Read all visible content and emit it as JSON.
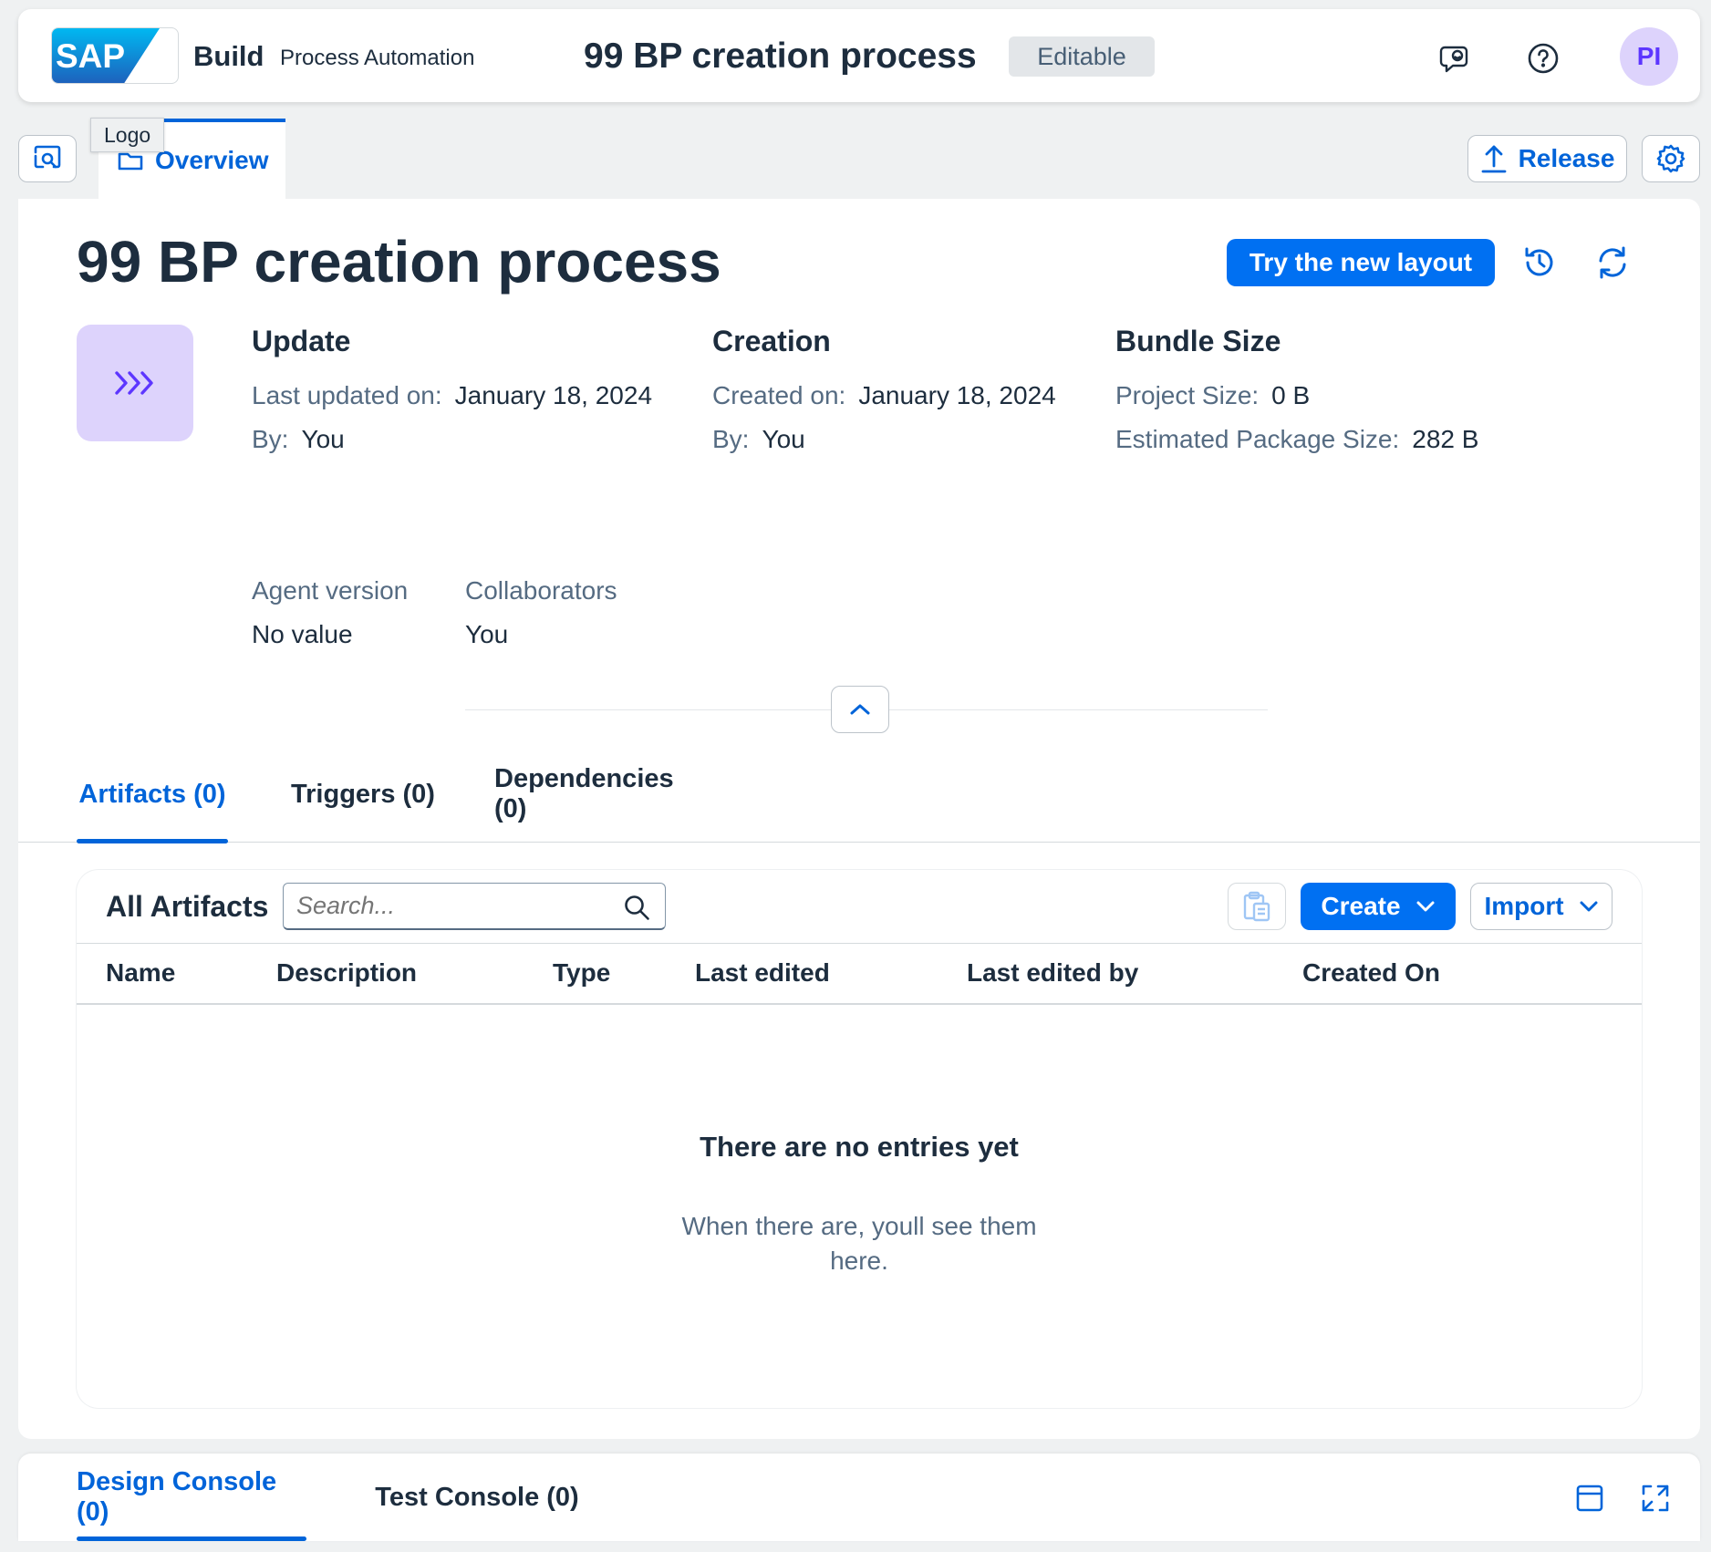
{
  "shell": {
    "logo_text": "SAP",
    "brand": "Build",
    "product": "Process Automation",
    "title": "99 BP creation process",
    "status_badge": "Editable",
    "avatar_initials": "PI"
  },
  "tabbar": {
    "tooltip": "Logo",
    "overview_label": "Overview",
    "release_label": "Release"
  },
  "project": {
    "title": "99 BP creation process",
    "try_new_layout": "Try the new layout",
    "update": {
      "heading": "Update",
      "last_updated_label": "Last updated on:",
      "last_updated_value": "January 18, 2024",
      "by_label": "By:",
      "by_value": "You"
    },
    "creation": {
      "heading": "Creation",
      "created_label": "Created on:",
      "created_value": "January 18, 2024",
      "by_label": "By:",
      "by_value": "You"
    },
    "bundle": {
      "heading": "Bundle Size",
      "project_size_label": "Project Size:",
      "project_size_value": "0 B",
      "package_size_label": "Estimated Package Size:",
      "package_size_value": "282 B"
    },
    "agent_version_label": "Agent version",
    "agent_version_value": "No value",
    "collaborators_label": "Collaborators",
    "collaborators_value": "You"
  },
  "section_tabs": [
    {
      "label": "Artifacts (0)",
      "active": true
    },
    {
      "label": "Triggers (0)",
      "active": false
    },
    {
      "label": "Dependencies (0)",
      "active": false
    }
  ],
  "artifacts": {
    "title": "All Artifacts",
    "search_placeholder": "Search...",
    "create_label": "Create",
    "import_label": "Import",
    "columns": [
      "Name",
      "Description",
      "Type",
      "Last edited",
      "Last edited by",
      "Created On"
    ],
    "rows": [],
    "empty_title": "There are no entries yet",
    "empty_subtitle": "When there are, youll see them here."
  },
  "console": {
    "tabs": [
      {
        "label": "Design Console (0)",
        "active": true
      },
      {
        "label": "Test Console (0)",
        "active": false
      }
    ]
  },
  "colors": {
    "accent": "#0064d9",
    "primary_button": "#0070f2",
    "avatar_bg": "#ddd3fc",
    "avatar_text": "#5d36ff",
    "text": "#1d2d3e",
    "label": "#556b82",
    "background": "#eff1f2"
  },
  "icons": {
    "shell": [
      "feedback-icon",
      "help-icon"
    ],
    "tabbar": [
      "search-explore-icon",
      "overview-folder-icon",
      "upload-icon",
      "settings-gear-icon"
    ],
    "header": [
      "history-icon",
      "refresh-icon"
    ],
    "process_tile": "process-chevrons-icon",
    "collapse": "chevron-up-icon",
    "toolbar": [
      "paste-icon",
      "search-icon",
      "chevron-down-icon"
    ],
    "console": [
      "panel-icon",
      "expand-icon"
    ]
  }
}
